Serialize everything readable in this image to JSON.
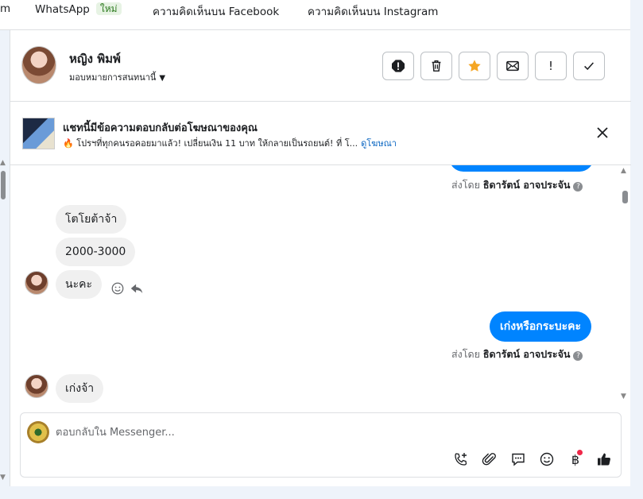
{
  "tabs": [
    {
      "label": "m"
    },
    {
      "label": "WhatsApp",
      "badge": "ใหม่"
    },
    {
      "label": "ความคิดเห็นบน Facebook"
    },
    {
      "label": "ความคิดเห็นบน Instagram"
    }
  ],
  "header": {
    "contact_name": "หญิง พิมพ์",
    "assign_label": "มอบหมายการสนทนานี้"
  },
  "ad": {
    "title": "แชทนี้มีข้อความตอบกลับต่อโฆษณาของคุณ",
    "description": "🔥 โปรฯที่ทุกคนรอคอยมาแล้ว! เปลี่ยนเงิน 11 บาท ให้กลายเป็นรถยนต์! ที่ โ...",
    "link": "ดูโฆษณา"
  },
  "messages": {
    "sent_by_prefix": "ส่งโดย",
    "agent_name": "ธิดารัตน์ อาจประจัน",
    "in_1": "โตโยต้าจ้า",
    "in_2": "2000-3000",
    "in_3": "นะคะ",
    "out_1": "เก่งหรือกระบะคะ",
    "in_4": "เก่งจ้า",
    "help_glyph": "?"
  },
  "composer": {
    "placeholder": "ตอบกลับใน Messenger..."
  },
  "icons": {
    "baht_glyph": "฿",
    "exclaim_glyph": "!"
  },
  "colors": {
    "outgoing_bubble": "#0084ff",
    "incoming_bubble": "#f0f0f0",
    "star": "#f5a623",
    "notification_dot": "#f02849",
    "link": "#0a66c2"
  }
}
